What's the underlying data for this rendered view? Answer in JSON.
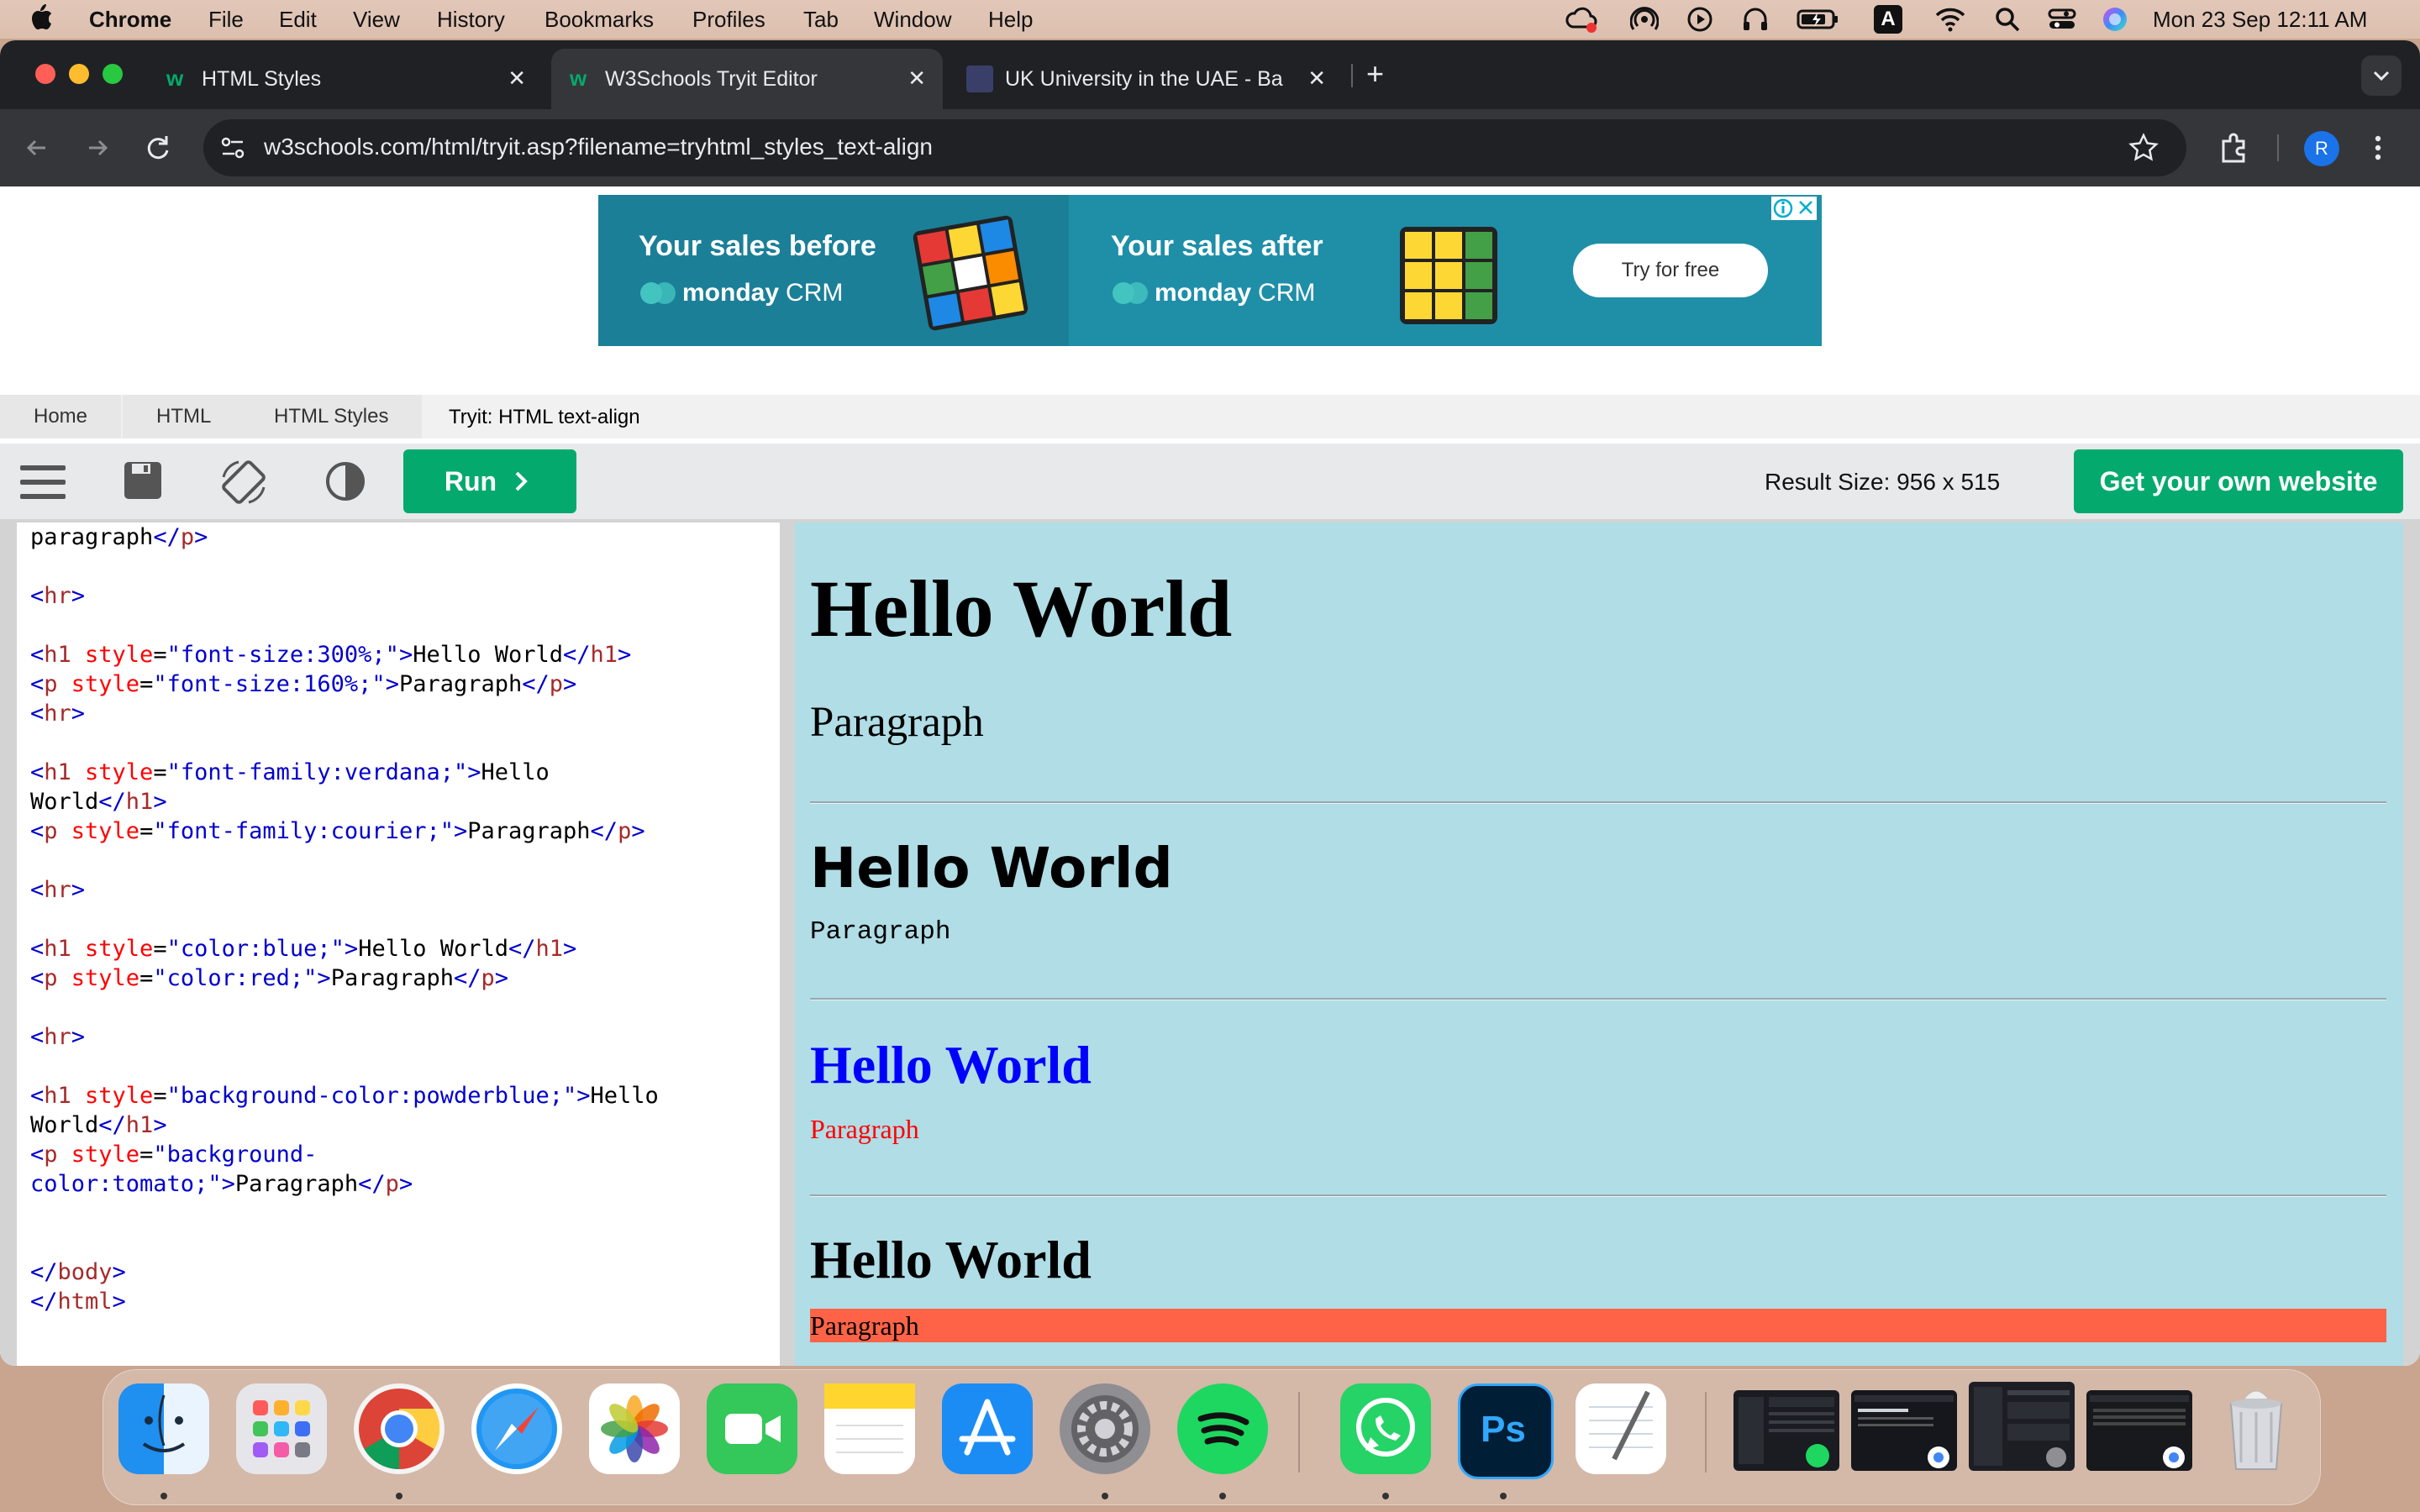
{
  "menubar": {
    "app": "Chrome",
    "items": [
      "File",
      "Edit",
      "View",
      "History",
      "Bookmarks",
      "Profiles",
      "Tab",
      "Window",
      "Help"
    ],
    "datetime": "Mon 23 Sep  12:11 AM",
    "input_indicator": "A"
  },
  "tabs": [
    {
      "title": "HTML Styles",
      "favicon": "w3schools-favicon",
      "active": false
    },
    {
      "title": "W3Schools Tryit Editor",
      "favicon": "w3schools-favicon",
      "active": true
    },
    {
      "title": "UK University in the UAE - Ba",
      "favicon": "bath-spa-favicon",
      "active": false
    }
  ],
  "toolbar": {
    "url": "w3schools.com/html/tryit.asp?filename=tryhtml_styles_text-align",
    "profile_initial": "R"
  },
  "ad": {
    "before_label": "Your sales before",
    "after_label": "Your sales after",
    "brand": "monday",
    "brand_suffix": "CRM",
    "cta": "Try for free"
  },
  "breadcrumb": [
    "Home",
    "HTML",
    "HTML Styles",
    "Tryit: HTML text-align"
  ],
  "tryit": {
    "run_label": "Run",
    "result_size": "Result Size: 956 x 515",
    "get_website": "Get your own website"
  },
  "code_lines": [
    [
      {
        "c": "tx",
        "t": "paragraph"
      },
      {
        "c": "br",
        "t": "</"
      },
      {
        "c": "tg",
        "t": "p"
      },
      {
        "c": "br",
        "t": ">"
      }
    ],
    [],
    [
      {
        "c": "br",
        "t": "<"
      },
      {
        "c": "tg",
        "t": "hr"
      },
      {
        "c": "br",
        "t": ">"
      }
    ],
    [],
    [
      {
        "c": "br",
        "t": "<"
      },
      {
        "c": "tg",
        "t": "h1"
      },
      {
        "c": "at",
        "t": " style"
      },
      {
        "c": "tx",
        "t": "="
      },
      {
        "c": "vl",
        "t": "\"font-size:300%;\""
      },
      {
        "c": "br",
        "t": ">"
      },
      {
        "c": "tx",
        "t": "Hello World"
      },
      {
        "c": "br",
        "t": "</"
      },
      {
        "c": "tg",
        "t": "h1"
      },
      {
        "c": "br",
        "t": ">"
      }
    ],
    [
      {
        "c": "br",
        "t": "<"
      },
      {
        "c": "tg",
        "t": "p"
      },
      {
        "c": "at",
        "t": " style"
      },
      {
        "c": "tx",
        "t": "="
      },
      {
        "c": "vl",
        "t": "\"font-size:160%;\""
      },
      {
        "c": "br",
        "t": ">"
      },
      {
        "c": "tx",
        "t": "Paragraph"
      },
      {
        "c": "br",
        "t": "</"
      },
      {
        "c": "tg",
        "t": "p"
      },
      {
        "c": "br",
        "t": ">"
      }
    ],
    [
      {
        "c": "br",
        "t": "<"
      },
      {
        "c": "tg",
        "t": "hr"
      },
      {
        "c": "br",
        "t": ">"
      }
    ],
    [],
    [
      {
        "c": "br",
        "t": "<"
      },
      {
        "c": "tg",
        "t": "h1"
      },
      {
        "c": "at",
        "t": " style"
      },
      {
        "c": "tx",
        "t": "="
      },
      {
        "c": "vl",
        "t": "\"font-family:verdana;\""
      },
      {
        "c": "br",
        "t": ">"
      },
      {
        "c": "tx",
        "t": "Hello"
      }
    ],
    [
      {
        "c": "tx",
        "t": "World"
      },
      {
        "c": "br",
        "t": "</"
      },
      {
        "c": "tg",
        "t": "h1"
      },
      {
        "c": "br",
        "t": ">"
      }
    ],
    [
      {
        "c": "br",
        "t": "<"
      },
      {
        "c": "tg",
        "t": "p"
      },
      {
        "c": "at",
        "t": " style"
      },
      {
        "c": "tx",
        "t": "="
      },
      {
        "c": "vl",
        "t": "\"font-family:courier;\""
      },
      {
        "c": "br",
        "t": ">"
      },
      {
        "c": "tx",
        "t": "Paragraph"
      },
      {
        "c": "br",
        "t": "</"
      },
      {
        "c": "tg",
        "t": "p"
      },
      {
        "c": "br",
        "t": ">"
      }
    ],
    [],
    [
      {
        "c": "br",
        "t": "<"
      },
      {
        "c": "tg",
        "t": "hr"
      },
      {
        "c": "br",
        "t": ">"
      }
    ],
    [],
    [
      {
        "c": "br",
        "t": "<"
      },
      {
        "c": "tg",
        "t": "h1"
      },
      {
        "c": "at",
        "t": " style"
      },
      {
        "c": "tx",
        "t": "="
      },
      {
        "c": "vl",
        "t": "\"color:blue;\""
      },
      {
        "c": "br",
        "t": ">"
      },
      {
        "c": "tx",
        "t": "Hello World"
      },
      {
        "c": "br",
        "t": "</"
      },
      {
        "c": "tg",
        "t": "h1"
      },
      {
        "c": "br",
        "t": ">"
      }
    ],
    [
      {
        "c": "br",
        "t": "<"
      },
      {
        "c": "tg",
        "t": "p"
      },
      {
        "c": "at",
        "t": " style"
      },
      {
        "c": "tx",
        "t": "="
      },
      {
        "c": "vl",
        "t": "\"color:red;\""
      },
      {
        "c": "br",
        "t": ">"
      },
      {
        "c": "tx",
        "t": "Paragraph"
      },
      {
        "c": "br",
        "t": "</"
      },
      {
        "c": "tg",
        "t": "p"
      },
      {
        "c": "br",
        "t": ">"
      }
    ],
    [],
    [
      {
        "c": "br",
        "t": "<"
      },
      {
        "c": "tg",
        "t": "hr"
      },
      {
        "c": "br",
        "t": ">"
      }
    ],
    [],
    [
      {
        "c": "br",
        "t": "<"
      },
      {
        "c": "tg",
        "t": "h1"
      },
      {
        "c": "at",
        "t": " style"
      },
      {
        "c": "tx",
        "t": "="
      },
      {
        "c": "vl",
        "t": "\"background-color:powderblue;\""
      },
      {
        "c": "br",
        "t": ">"
      },
      {
        "c": "tx",
        "t": "Hello"
      }
    ],
    [
      {
        "c": "tx",
        "t": "World"
      },
      {
        "c": "br",
        "t": "</"
      },
      {
        "c": "tg",
        "t": "h1"
      },
      {
        "c": "br",
        "t": ">"
      }
    ],
    [
      {
        "c": "br",
        "t": "<"
      },
      {
        "c": "tg",
        "t": "p"
      },
      {
        "c": "at",
        "t": " style"
      },
      {
        "c": "tx",
        "t": "="
      },
      {
        "c": "vl",
        "t": "\"background-"
      }
    ],
    [
      {
        "c": "vl",
        "t": "color:tomato;\""
      },
      {
        "c": "br",
        "t": ">"
      },
      {
        "c": "tx",
        "t": "Paragraph"
      },
      {
        "c": "br",
        "t": "</"
      },
      {
        "c": "tg",
        "t": "p"
      },
      {
        "c": "br",
        "t": ">"
      }
    ],
    [],
    [],
    [
      {
        "c": "br",
        "t": "</"
      },
      {
        "c": "tg",
        "t": "body"
      },
      {
        "c": "br",
        "t": ">"
      }
    ],
    [
      {
        "c": "br",
        "t": "</"
      },
      {
        "c": "tg",
        "t": "html"
      },
      {
        "c": "br",
        "t": ">"
      }
    ]
  ],
  "result": {
    "h1_size": "Hello World",
    "p_size": "Paragraph",
    "h1_verdana": "Hello World",
    "p_courier": "Paragraph",
    "h1_blue": "Hello World",
    "p_red": "Paragraph",
    "h1_bg": "Hello World",
    "p_tomato": "Paragraph",
    "colors": {
      "background": "#b0dde6",
      "blue": "#0000ff",
      "red": "#ff0000",
      "tomato": "#ff6347"
    }
  },
  "dock": [
    "Finder",
    "Launchpad",
    "Google Chrome",
    "Safari",
    "Photos",
    "FaceTime",
    "Notes",
    "App Store",
    "System Settings",
    "Spotify",
    "WhatsApp",
    "Photoshop",
    "TextEdit",
    "Window preview 1",
    "Window preview 2",
    "Window preview 3",
    "Window preview 4",
    "Trash"
  ]
}
